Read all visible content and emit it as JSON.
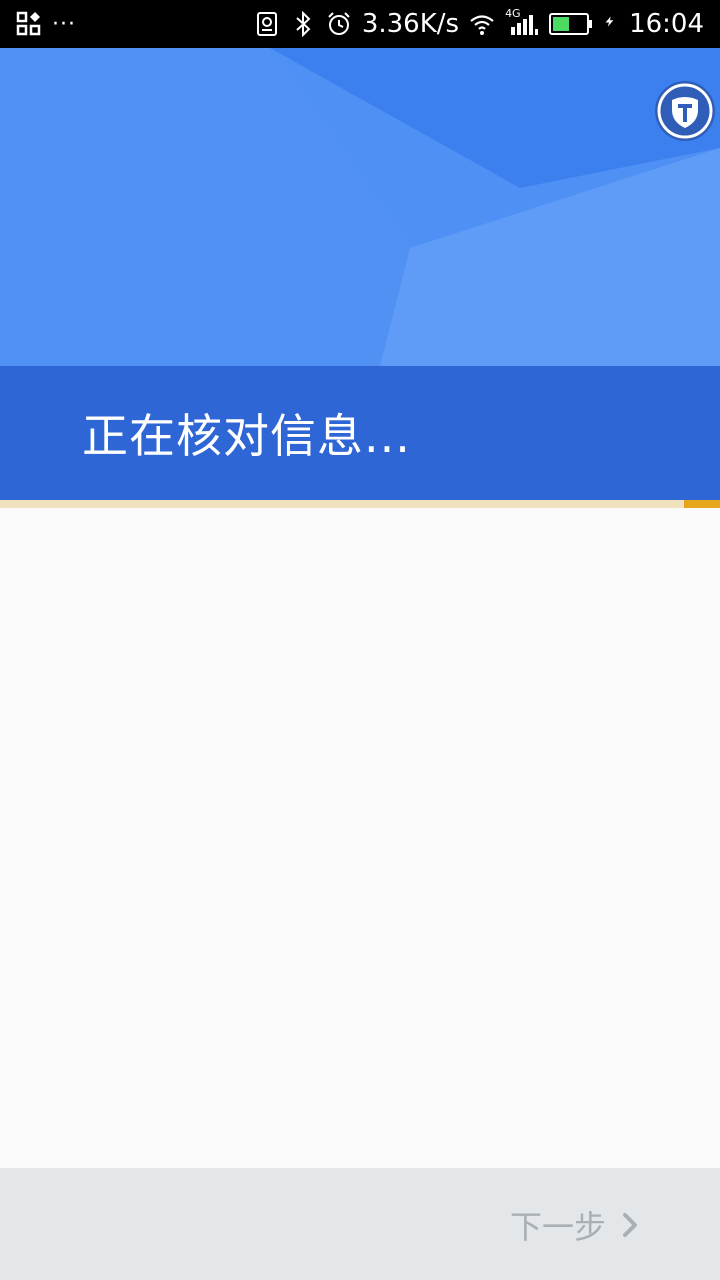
{
  "status_bar": {
    "network_speed": "3.36K/s",
    "network_type": "4G",
    "time": "16:04",
    "left_icons": [
      "qr-scan-icon",
      "more-dots-icon"
    ],
    "right_icons": [
      "sim-card-icon",
      "bluetooth-icon",
      "alarm-icon",
      "wifi-icon",
      "cellular-signal-icon",
      "battery-icon",
      "charging-icon"
    ],
    "more_dots": "···"
  },
  "header": {
    "title": "正在核对信息...",
    "badge_icon": "shield-t-icon",
    "colors": {
      "top": "#4a8cf2",
      "band": "#2f66d6"
    }
  },
  "progress": {
    "percent": 5,
    "track_color": "#f0e2bf",
    "fill_color": "#e7a71c"
  },
  "footer": {
    "next_label": "下一步",
    "next_icon": "chevron-right-icon"
  }
}
